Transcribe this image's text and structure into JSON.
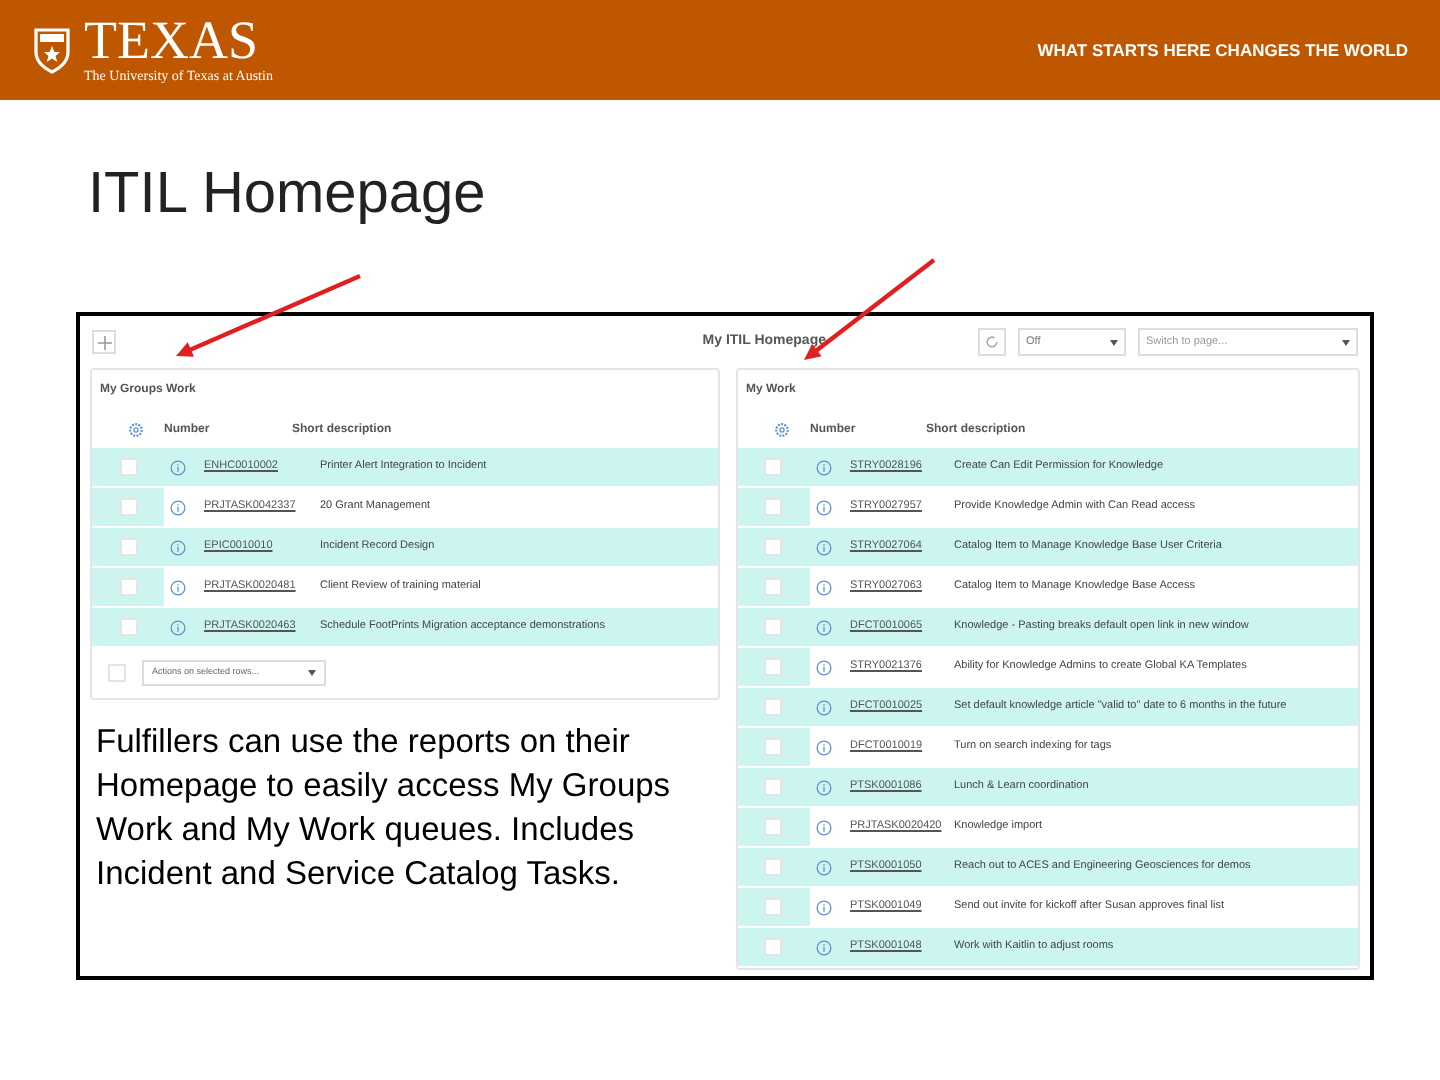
{
  "header": {
    "logo_word": "TEXAS",
    "logo_subtitle": "The University of Texas at Austin",
    "tagline": "WHAT STARTS HERE CHANGES THE WORLD"
  },
  "slide_title": "ITIL Homepage",
  "screenshot": {
    "title": "My ITIL Homepage",
    "refresh_select": "Off",
    "page_select_placeholder": "Switch to page...",
    "groups_work": {
      "title": "My Groups Work",
      "columns": [
        "Number",
        "Short description"
      ],
      "rows": [
        {
          "number": "ENHC0010002",
          "description": "Printer Alert Integration to Incident",
          "checked": false
        },
        {
          "number": "PRJTASK0042337",
          "description": "20 Grant Management",
          "checked": false
        },
        {
          "number": "EPIC0010010",
          "description": "Incident Record Design",
          "checked": false
        },
        {
          "number": "PRJTASK0020481",
          "description": "Client Review of training material",
          "checked": false
        },
        {
          "number": "PRJTASK0020463",
          "description": "Schedule FootPrints Migration acceptance demonstrations",
          "checked": false
        }
      ],
      "select_all_checked": false,
      "actions": "Actions on selected rows..."
    },
    "my_work": {
      "title": "My Work",
      "columns": [
        "Number",
        "Short description"
      ],
      "rows": [
        {
          "number": "STRY0028196",
          "description": "Create Can Edit Permission for Knowledge",
          "checked": false
        },
        {
          "number": "STRY0027957",
          "description": "Provide Knowledge Admin with Can Read access",
          "checked": false
        },
        {
          "number": "STRY0027064",
          "description": "Catalog Item to Manage Knowledge Base User Criteria",
          "checked": false
        },
        {
          "number": "STRY0027063",
          "description": "Catalog Item to Manage Knowledge Base Access",
          "checked": false
        },
        {
          "number": "DFCT0010065",
          "description": "Knowledge - Pasting breaks default open link in new window",
          "checked": false
        },
        {
          "number": "STRY0021376",
          "description": "Ability for Knowledge Admins to create Global KA Templates",
          "checked": false
        },
        {
          "number": "DFCT0010025",
          "description": "Set default knowledge article \"valid to\" date to 6 months in the future",
          "checked": false
        },
        {
          "number": "DFCT0010019",
          "description": "Turn on search indexing for tags",
          "checked": false
        },
        {
          "number": "PTSK0001086",
          "description": "Lunch & Learn coordination",
          "checked": false
        },
        {
          "number": "PRJTASK0020420",
          "description": "Knowledge import",
          "checked": false
        },
        {
          "number": "PTSK0001050",
          "description": "Reach out to ACES and Engineering Geosciences for demos",
          "checked": false
        },
        {
          "number": "PTSK0001049",
          "description": "Send out invite for kickoff after Susan approves final list",
          "checked": false
        },
        {
          "number": "PTSK0001048",
          "description": "Work with Kaitlin to adjust rooms",
          "checked": false
        }
      ]
    }
  },
  "caption": "Fulfillers can use the reports on their Homepage to easily access My Groups Work and My Work queues. Includes Incident and Service Catalog Tasks."
}
